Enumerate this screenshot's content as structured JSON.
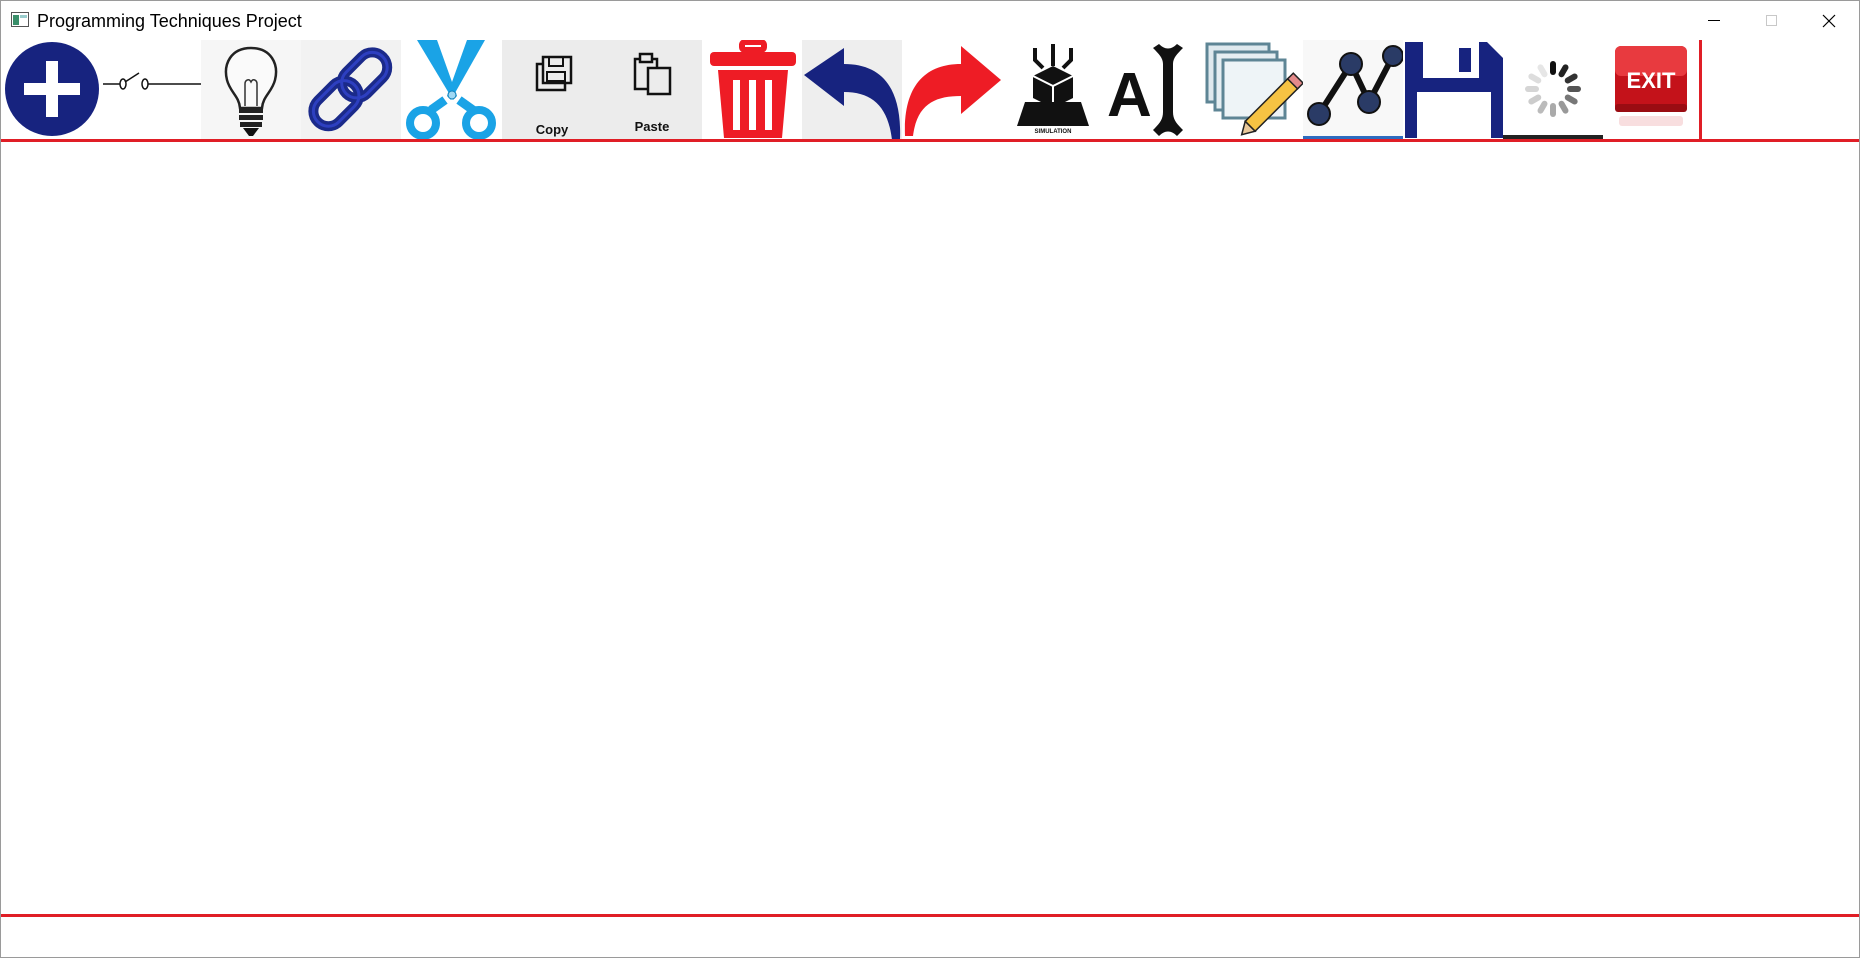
{
  "window": {
    "title": "Programming Techniques Project",
    "controls": [
      "minimize",
      "maximize",
      "close"
    ]
  },
  "toolbar": {
    "tools": [
      {
        "id": "add",
        "icon": "add-circle-icon"
      },
      {
        "id": "switch",
        "icon": "switch-icon"
      },
      {
        "id": "bulb",
        "icon": "light-bulb-icon"
      },
      {
        "id": "link",
        "icon": "chain-link-icon"
      },
      {
        "id": "cut",
        "icon": "scissors-icon"
      },
      {
        "id": "copy",
        "icon": "copy-icon",
        "label": "Copy"
      },
      {
        "id": "paste",
        "icon": "paste-icon",
        "label": "Paste"
      },
      {
        "id": "delete",
        "icon": "trash-icon"
      },
      {
        "id": "undo",
        "icon": "undo-arrow-icon"
      },
      {
        "id": "redo",
        "icon": "redo-arrow-icon"
      },
      {
        "id": "simulation",
        "icon": "simulation-icon",
        "label": "SIMULATION"
      },
      {
        "id": "label",
        "icon": "text-cursor-icon",
        "label": "A"
      },
      {
        "id": "edit",
        "icon": "edit-pages-icon"
      },
      {
        "id": "connection",
        "icon": "connection-nodes-icon"
      },
      {
        "id": "save",
        "icon": "floppy-disk-icon"
      },
      {
        "id": "load",
        "icon": "loading-spinner-icon"
      },
      {
        "id": "exit",
        "icon": "exit-sign-icon",
        "label": "EXIT"
      }
    ]
  },
  "colors": {
    "accent": "#e01e26",
    "navy": "#17237f",
    "scissors": "#1aa3e6",
    "redo": "#ee1c25",
    "button_bg": "#ececec"
  }
}
